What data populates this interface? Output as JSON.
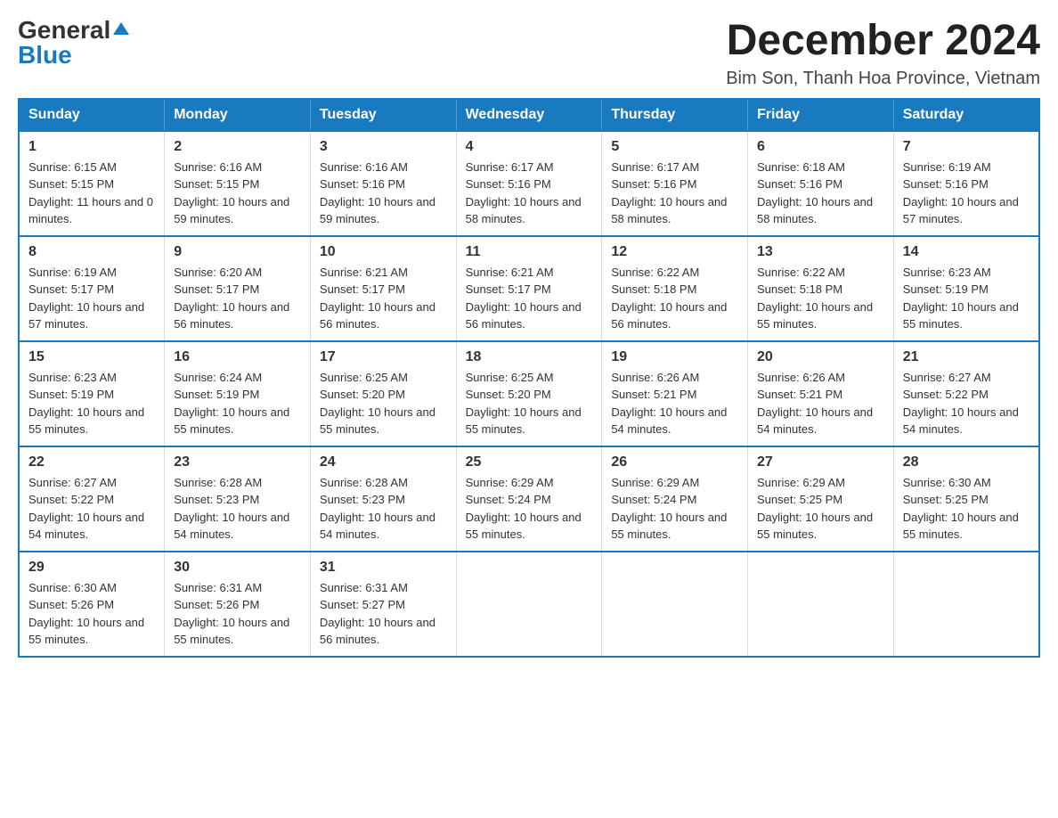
{
  "logo": {
    "general": "General",
    "blue": "Blue",
    "triangle": "▲"
  },
  "title": {
    "month_year": "December 2024",
    "location": "Bim Son, Thanh Hoa Province, Vietnam"
  },
  "headers": [
    "Sunday",
    "Monday",
    "Tuesday",
    "Wednesday",
    "Thursday",
    "Friday",
    "Saturday"
  ],
  "weeks": [
    [
      {
        "day": "1",
        "sunrise": "6:15 AM",
        "sunset": "5:15 PM",
        "daylight": "11 hours and 0 minutes."
      },
      {
        "day": "2",
        "sunrise": "6:16 AM",
        "sunset": "5:15 PM",
        "daylight": "10 hours and 59 minutes."
      },
      {
        "day": "3",
        "sunrise": "6:16 AM",
        "sunset": "5:16 PM",
        "daylight": "10 hours and 59 minutes."
      },
      {
        "day": "4",
        "sunrise": "6:17 AM",
        "sunset": "5:16 PM",
        "daylight": "10 hours and 58 minutes."
      },
      {
        "day": "5",
        "sunrise": "6:17 AM",
        "sunset": "5:16 PM",
        "daylight": "10 hours and 58 minutes."
      },
      {
        "day": "6",
        "sunrise": "6:18 AM",
        "sunset": "5:16 PM",
        "daylight": "10 hours and 58 minutes."
      },
      {
        "day": "7",
        "sunrise": "6:19 AM",
        "sunset": "5:16 PM",
        "daylight": "10 hours and 57 minutes."
      }
    ],
    [
      {
        "day": "8",
        "sunrise": "6:19 AM",
        "sunset": "5:17 PM",
        "daylight": "10 hours and 57 minutes."
      },
      {
        "day": "9",
        "sunrise": "6:20 AM",
        "sunset": "5:17 PM",
        "daylight": "10 hours and 56 minutes."
      },
      {
        "day": "10",
        "sunrise": "6:21 AM",
        "sunset": "5:17 PM",
        "daylight": "10 hours and 56 minutes."
      },
      {
        "day": "11",
        "sunrise": "6:21 AM",
        "sunset": "5:17 PM",
        "daylight": "10 hours and 56 minutes."
      },
      {
        "day": "12",
        "sunrise": "6:22 AM",
        "sunset": "5:18 PM",
        "daylight": "10 hours and 56 minutes."
      },
      {
        "day": "13",
        "sunrise": "6:22 AM",
        "sunset": "5:18 PM",
        "daylight": "10 hours and 55 minutes."
      },
      {
        "day": "14",
        "sunrise": "6:23 AM",
        "sunset": "5:19 PM",
        "daylight": "10 hours and 55 minutes."
      }
    ],
    [
      {
        "day": "15",
        "sunrise": "6:23 AM",
        "sunset": "5:19 PM",
        "daylight": "10 hours and 55 minutes."
      },
      {
        "day": "16",
        "sunrise": "6:24 AM",
        "sunset": "5:19 PM",
        "daylight": "10 hours and 55 minutes."
      },
      {
        "day": "17",
        "sunrise": "6:25 AM",
        "sunset": "5:20 PM",
        "daylight": "10 hours and 55 minutes."
      },
      {
        "day": "18",
        "sunrise": "6:25 AM",
        "sunset": "5:20 PM",
        "daylight": "10 hours and 55 minutes."
      },
      {
        "day": "19",
        "sunrise": "6:26 AM",
        "sunset": "5:21 PM",
        "daylight": "10 hours and 54 minutes."
      },
      {
        "day": "20",
        "sunrise": "6:26 AM",
        "sunset": "5:21 PM",
        "daylight": "10 hours and 54 minutes."
      },
      {
        "day": "21",
        "sunrise": "6:27 AM",
        "sunset": "5:22 PM",
        "daylight": "10 hours and 54 minutes."
      }
    ],
    [
      {
        "day": "22",
        "sunrise": "6:27 AM",
        "sunset": "5:22 PM",
        "daylight": "10 hours and 54 minutes."
      },
      {
        "day": "23",
        "sunrise": "6:28 AM",
        "sunset": "5:23 PM",
        "daylight": "10 hours and 54 minutes."
      },
      {
        "day": "24",
        "sunrise": "6:28 AM",
        "sunset": "5:23 PM",
        "daylight": "10 hours and 54 minutes."
      },
      {
        "day": "25",
        "sunrise": "6:29 AM",
        "sunset": "5:24 PM",
        "daylight": "10 hours and 55 minutes."
      },
      {
        "day": "26",
        "sunrise": "6:29 AM",
        "sunset": "5:24 PM",
        "daylight": "10 hours and 55 minutes."
      },
      {
        "day": "27",
        "sunrise": "6:29 AM",
        "sunset": "5:25 PM",
        "daylight": "10 hours and 55 minutes."
      },
      {
        "day": "28",
        "sunrise": "6:30 AM",
        "sunset": "5:25 PM",
        "daylight": "10 hours and 55 minutes."
      }
    ],
    [
      {
        "day": "29",
        "sunrise": "6:30 AM",
        "sunset": "5:26 PM",
        "daylight": "10 hours and 55 minutes."
      },
      {
        "day": "30",
        "sunrise": "6:31 AM",
        "sunset": "5:26 PM",
        "daylight": "10 hours and 55 minutes."
      },
      {
        "day": "31",
        "sunrise": "6:31 AM",
        "sunset": "5:27 PM",
        "daylight": "10 hours and 56 minutes."
      },
      null,
      null,
      null,
      null
    ]
  ]
}
